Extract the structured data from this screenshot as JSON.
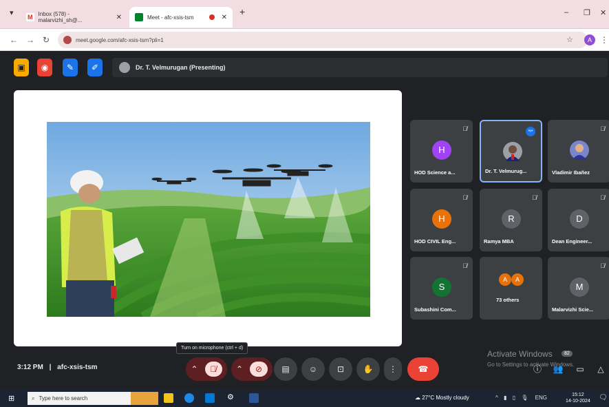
{
  "browser": {
    "tabs": [
      {
        "title": "Inbox (578) - malarvizhi_sh@...",
        "favicon_color": "#d93025"
      },
      {
        "title": "Meet - afc-xsis-tsm",
        "favicon_color": "#00832d"
      }
    ],
    "new_tab": "+",
    "url": "meet.google.com/afc-xsis-tsm?pli=1",
    "profile_initial": "A"
  },
  "meet": {
    "header": {
      "presenter_label": "Dr. T. Velmurugan (Presenting)"
    },
    "participants": [
      {
        "name": "HOD Science a...",
        "initial": "H",
        "color": "#a142f4",
        "muted": true
      },
      {
        "name": "Dr. T. Velmurug...",
        "initial": "",
        "color": "#9aa0a6",
        "speaking": true
      },
      {
        "name": "Vladimir Ibañez",
        "initial": "",
        "color": "#7986cb",
        "muted": true
      },
      {
        "name": "HOD CIVIL Eng...",
        "initial": "H",
        "color": "#e8710a",
        "muted": true
      },
      {
        "name": "Ramya MBA",
        "initial": "R",
        "color": "#5f6368",
        "muted": true
      },
      {
        "name": "Dean Engineer...",
        "initial": "D",
        "color": "#5f6368",
        "muted": true
      },
      {
        "name": "Subashini Com...",
        "initial": "S",
        "color": "#137333",
        "muted": true
      },
      {
        "name": "73 others",
        "initial": "A",
        "color": "#e8710a"
      },
      {
        "name": "Malarvizhi Scie...",
        "initial": "M",
        "color": "#5f6368",
        "muted": true
      }
    ],
    "bottom": {
      "time": "3:12 PM",
      "separator": "|",
      "meeting_code": "afc-xsis-tsm",
      "tooltip": "Turn on microphone (ctrl + d)",
      "activate_title": "Activate Windows",
      "activate_sub": "Go to Settings to activate Windows.",
      "badge": "82"
    }
  },
  "taskbar": {
    "search_placeholder": "Type here to search",
    "weather": "27°C  Mostly cloudy",
    "lang": "ENG",
    "time": "15:12",
    "date": "14-10-2024"
  },
  "colors": {
    "end_call": "#ea4335",
    "speaking_border": "#8ab4f8"
  }
}
